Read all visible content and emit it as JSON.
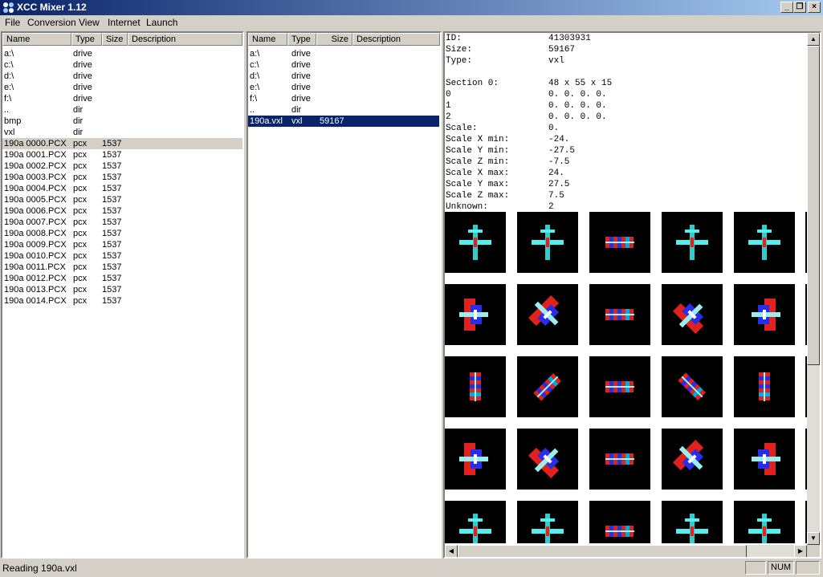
{
  "window": {
    "title": "XCC Mixer 1.12"
  },
  "menu": [
    "File",
    "Conversion",
    "View",
    "Internet",
    "Launch"
  ],
  "columns": {
    "name": "Name",
    "type": "Type",
    "size": "Size",
    "description": "Description"
  },
  "left_panel": {
    "rows": [
      {
        "name": "a:\\",
        "type": "drive",
        "size": ""
      },
      {
        "name": "c:\\",
        "type": "drive",
        "size": ""
      },
      {
        "name": "d:\\",
        "type": "drive",
        "size": ""
      },
      {
        "name": "e:\\",
        "type": "drive",
        "size": ""
      },
      {
        "name": "f:\\",
        "type": "drive",
        "size": ""
      },
      {
        "name": "..",
        "type": "dir",
        "size": ""
      },
      {
        "name": "bmp",
        "type": "dir",
        "size": ""
      },
      {
        "name": "vxl",
        "type": "dir",
        "size": ""
      },
      {
        "name": "190a 0000.PCX",
        "type": "pcx",
        "size": "1537"
      },
      {
        "name": "190a 0001.PCX",
        "type": "pcx",
        "size": "1537"
      },
      {
        "name": "190a 0002.PCX",
        "type": "pcx",
        "size": "1537"
      },
      {
        "name": "190a 0003.PCX",
        "type": "pcx",
        "size": "1537"
      },
      {
        "name": "190a 0004.PCX",
        "type": "pcx",
        "size": "1537"
      },
      {
        "name": "190a 0005.PCX",
        "type": "pcx",
        "size": "1537"
      },
      {
        "name": "190a 0006.PCX",
        "type": "pcx",
        "size": "1537"
      },
      {
        "name": "190a 0007.PCX",
        "type": "pcx",
        "size": "1537"
      },
      {
        "name": "190a 0008.PCX",
        "type": "pcx",
        "size": "1537"
      },
      {
        "name": "190a 0009.PCX",
        "type": "pcx",
        "size": "1537"
      },
      {
        "name": "190a 0010.PCX",
        "type": "pcx",
        "size": "1537"
      },
      {
        "name": "190a 0011.PCX",
        "type": "pcx",
        "size": "1537"
      },
      {
        "name": "190a 0012.PCX",
        "type": "pcx",
        "size": "1537"
      },
      {
        "name": "190a 0013.PCX",
        "type": "pcx",
        "size": "1537"
      },
      {
        "name": "190a 0014.PCX",
        "type": "pcx",
        "size": "1537"
      }
    ]
  },
  "middle_panel": {
    "rows": [
      {
        "name": "a:\\",
        "type": "drive",
        "size": ""
      },
      {
        "name": "c:\\",
        "type": "drive",
        "size": ""
      },
      {
        "name": "d:\\",
        "type": "drive",
        "size": ""
      },
      {
        "name": "e:\\",
        "type": "drive",
        "size": ""
      },
      {
        "name": "f:\\",
        "type": "drive",
        "size": ""
      },
      {
        "name": "..",
        "type": "dir",
        "size": ""
      },
      {
        "name": "190a.vxl",
        "type": "vxl",
        "size": "59167"
      }
    ]
  },
  "info": [
    {
      "k": "ID:",
      "v": "41303931"
    },
    {
      "k": "Size:",
      "v": "59167"
    },
    {
      "k": "Type:",
      "v": "vxl"
    },
    {
      "k": "",
      "v": ""
    },
    {
      "k": "Section 0:",
      "v": "48 x 55 x 15"
    },
    {
      "k": "0",
      "v": "0. 0. 0. 0."
    },
    {
      "k": "1",
      "v": "0. 0. 0. 0."
    },
    {
      "k": "2",
      "v": "0. 0. 0. 0."
    },
    {
      "k": "Scale:",
      "v": "0."
    },
    {
      "k": "Scale X min:",
      "v": "-24."
    },
    {
      "k": "Scale Y min:",
      "v": "-27.5"
    },
    {
      "k": "Scale Z min:",
      "v": "-7.5"
    },
    {
      "k": "Scale X max:",
      "v": "24."
    },
    {
      "k": "Scale Y max:",
      "v": "27.5"
    },
    {
      "k": "Scale Z max:",
      "v": "7.5"
    },
    {
      "k": "Unknown:",
      "v": "2"
    }
  ],
  "status": {
    "text": "Reading 190a.vxl",
    "num": "NUM"
  },
  "colors": {
    "title_start": "#0a246a",
    "title_end": "#a6caf0",
    "selection": "#0a246a"
  }
}
